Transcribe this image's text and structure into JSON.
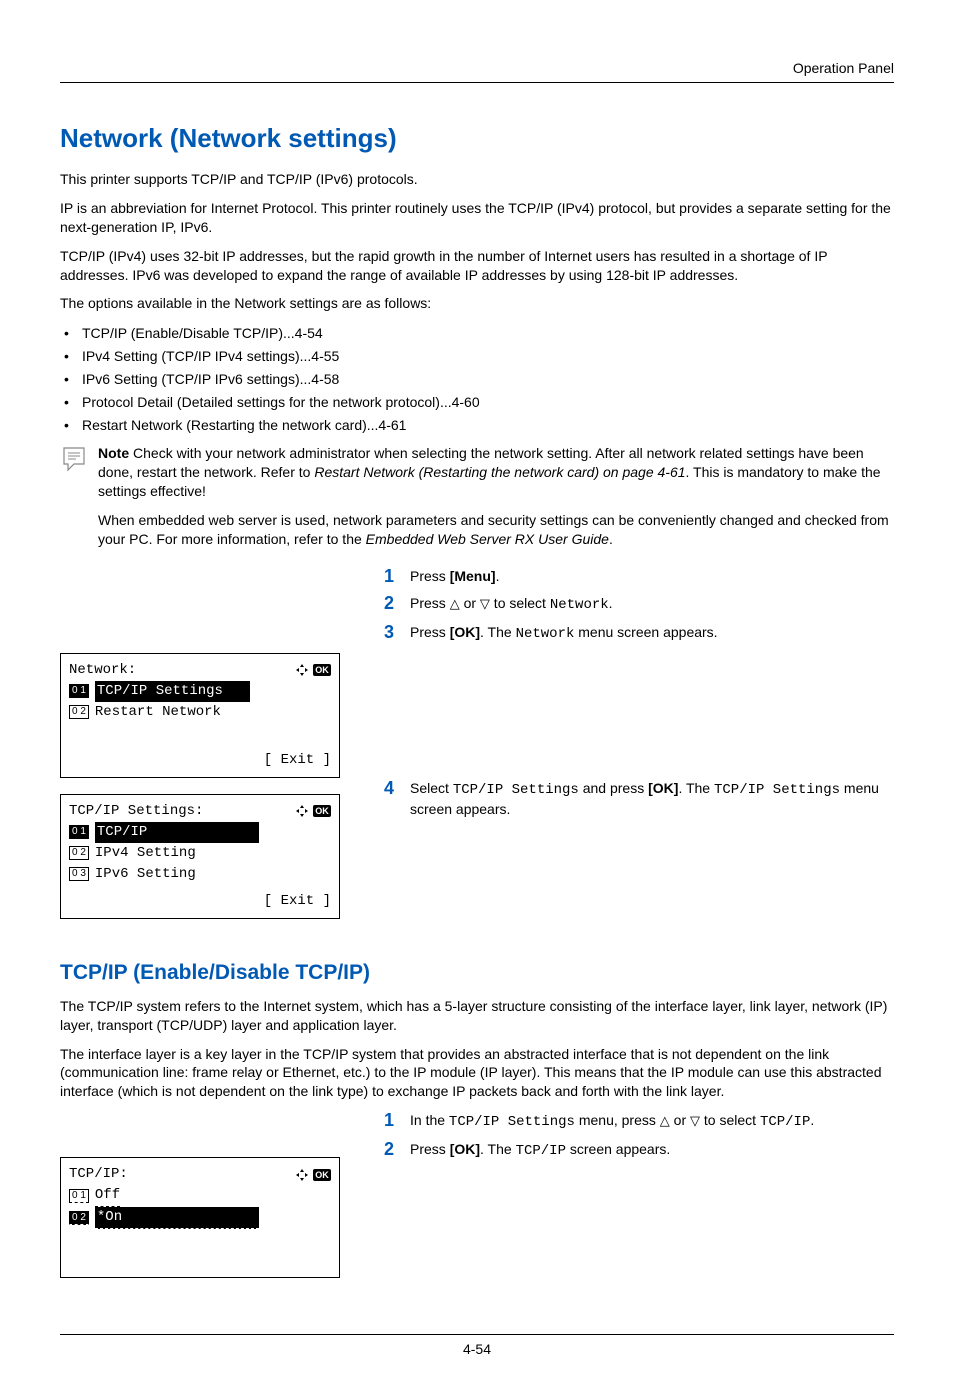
{
  "header": {
    "section": "Operation Panel"
  },
  "h1": "Network (Network settings)",
  "p_intro": "This printer supports TCP/IP and TCP/IP (IPv6) protocols.",
  "p_ip": "IP is an abbreviation for Internet Protocol. This printer routinely uses the TCP/IP (IPv4) protocol, but provides a separate setting for the next-generation IP, IPv6.",
  "p_tcpip": "TCP/IP (IPv4) uses 32-bit IP addresses, but the rapid growth in the number of Internet users has resulted in a shortage of IP addresses. IPv6 was developed to expand the range of available IP addresses by using 128-bit IP addresses.",
  "p_options": "The options available in the Network settings are as follows:",
  "bullets": [
    "TCP/IP (Enable/Disable TCP/IP)...4-54",
    "IPv4 Setting (TCP/IP IPv4 settings)...4-55",
    "IPv6 Setting (TCP/IP IPv6 settings)...4-58",
    "Protocol Detail (Detailed settings for the network protocol)...4-60",
    "Restart Network (Restarting the network card)...4-61"
  ],
  "note": {
    "label": "Note",
    "p1a": "  Check with your network administrator when selecting the network setting. After all network related settings have been done, restart the network. Refer to ",
    "p1_ital": "Restart Network (Restarting the network card) on page 4-61",
    "p1b": ". This is mandatory to make the settings effective!",
    "p2a": "When embedded web server is used, network parameters and security settings can be conveniently changed and checked from your PC. For more information, refer to the ",
    "p2_ital": "Embedded Web Server RX User Guide",
    "p2b": "."
  },
  "stepsA": {
    "s1_a": "Press ",
    "s1_b": "[Menu]",
    "s1_c": ".",
    "s2_a": "Press ",
    "s2_tri1": "△",
    "s2_mid": " or ",
    "s2_tri2": "▽",
    "s2_b": " to select ",
    "s2_mono": "Network",
    "s2_c": ".",
    "s3_a": "Press ",
    "s3_b": "[OK]",
    "s3_c": ". The ",
    "s3_mono": "Network",
    "s3_d": " menu screen appears.",
    "s4_a": "Select ",
    "s4_mono1": "TCP/IP Settings",
    "s4_b": " and press ",
    "s4_ok": "[OK]",
    "s4_c": ". The ",
    "s4_mono2": "TCP/IP Settings",
    "s4_d": " menu screen appears."
  },
  "lcd1": {
    "title": "Network:",
    "num1": "0 1",
    "item1": "TCP/IP Settings",
    "num2": "0 2",
    "item2": "Restart Network",
    "exit": "[  Exit  ]"
  },
  "lcd2": {
    "title": "TCP/IP Settings:",
    "num1": "0 1",
    "item1": "TCP/IP",
    "num2": "0 2",
    "item2": "IPv4 Setting",
    "num3": "0 3",
    "item3": "IPv6 Setting",
    "exit": "[  Exit  ]"
  },
  "h2": "TCP/IP (Enable/Disable TCP/IP)",
  "p_tcp1": "The TCP/IP system refers to the Internet system, which has a 5-layer structure consisting of the interface layer, link layer, network (IP) layer, transport (TCP/UDP) layer and application layer.",
  "p_tcp2": "The interface layer is a key layer in the TCP/IP system that provides an abstracted interface that is not dependent on the link (communication line: frame relay or Ethernet, etc.) to the IP module (IP layer). This means that the IP module can use this abstracted interface (which is not dependent on the link type) to exchange IP packets back and forth with the link layer.",
  "stepsB": {
    "s1_a": "In the ",
    "s1_mono": "TCP/IP Settings",
    "s1_b": " menu, press ",
    "s1_tri1": "△",
    "s1_mid": " or ",
    "s1_tri2": "▽",
    "s1_c": " to select ",
    "s1_mono2": "TCP/IP",
    "s1_d": ".",
    "s2_a": "Press ",
    "s2_b": "[OK]",
    "s2_c": ". The ",
    "s2_mono": "TCP/IP",
    "s2_d": " screen appears."
  },
  "lcd3": {
    "title": "TCP/IP:",
    "num1": "0 1",
    "item1": "Off",
    "num2": "0 2",
    "item2": "*On"
  },
  "nav_ok_label": "OK",
  "footer": "4-54",
  "step_nums": {
    "n1": "1",
    "n2": "2",
    "n3": "3",
    "n4": "4"
  }
}
